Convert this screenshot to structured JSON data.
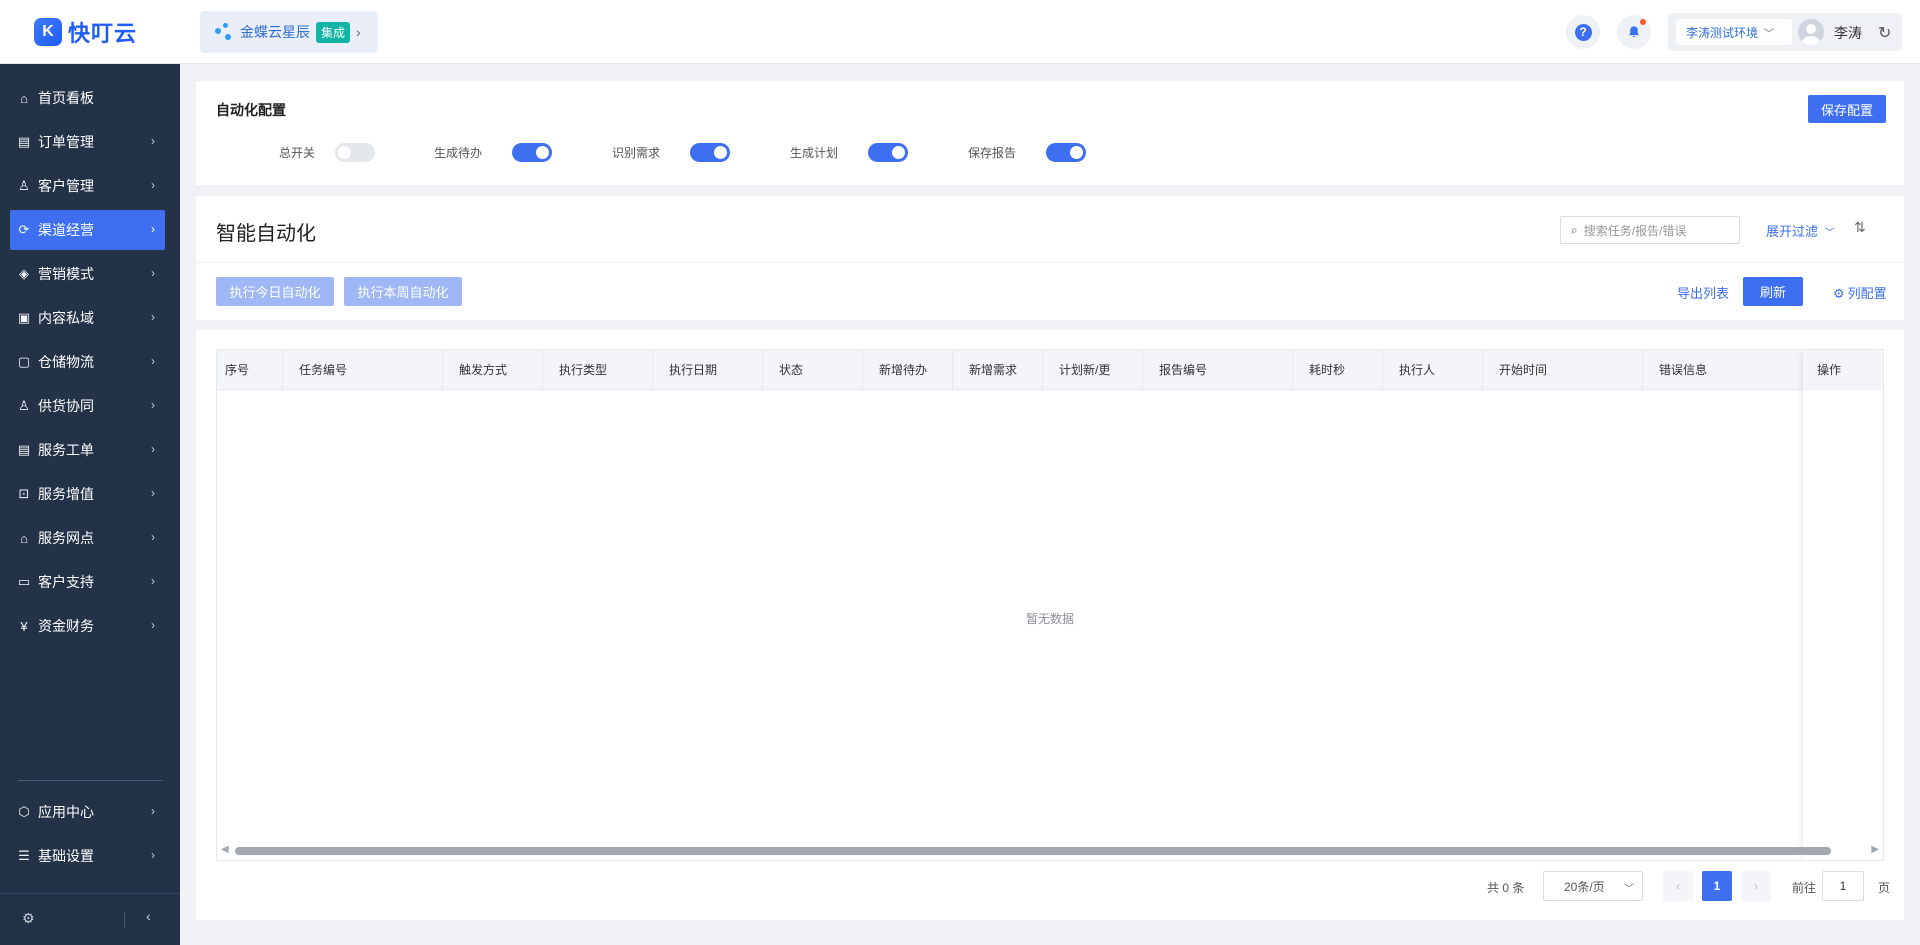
{
  "brand": {
    "name": "快叮云",
    "mark": "K"
  },
  "product": {
    "name": "金蝶云星辰",
    "tag": "集成",
    "chevron": "chevron-right-icon"
  },
  "header": {
    "help_icon": "question-icon",
    "notification_icon": "bell-icon",
    "environment": "李涛测试环境",
    "user_name": "李涛",
    "refresh_icon": "refresh-icon"
  },
  "sidebar": {
    "items": [
      {
        "label": "首页看板",
        "icon": "home-icon",
        "chevron": false,
        "active": false
      },
      {
        "label": "订单管理",
        "icon": "clipboard-icon",
        "chevron": true,
        "active": false
      },
      {
        "label": "客户管理",
        "icon": "user-icon",
        "chevron": true,
        "active": false
      },
      {
        "label": "渠道经营",
        "icon": "channel-icon",
        "chevron": true,
        "active": true
      },
      {
        "label": "营销模式",
        "icon": "tag-icon",
        "chevron": true,
        "active": false
      },
      {
        "label": "内容私域",
        "icon": "image-icon",
        "chevron": true,
        "active": false
      },
      {
        "label": "仓储物流",
        "icon": "warehouse-icon",
        "chevron": true,
        "active": false
      },
      {
        "label": "供货协同",
        "icon": "supply-icon",
        "chevron": true,
        "active": false
      },
      {
        "label": "服务工单",
        "icon": "ticket-icon",
        "chevron": true,
        "active": false
      },
      {
        "label": "服务增值",
        "icon": "bag-icon",
        "chevron": true,
        "active": false
      },
      {
        "label": "服务网点",
        "icon": "store-icon",
        "chevron": true,
        "active": false
      },
      {
        "label": "客户支持",
        "icon": "support-icon",
        "chevron": true,
        "active": false
      },
      {
        "label": "资金财务",
        "icon": "yen-icon",
        "chevron": true,
        "active": false
      }
    ],
    "bottom_items": [
      {
        "label": "应用中心",
        "icon": "cube-icon"
      },
      {
        "label": "基础设置",
        "icon": "sliders-icon"
      }
    ]
  },
  "config": {
    "title": "自动化配置",
    "save_label": "保存配置",
    "toggles": [
      {
        "label": "总开关",
        "on": false
      },
      {
        "label": "生成待办",
        "on": true
      },
      {
        "label": "识别需求",
        "on": true
      },
      {
        "label": "生成计划",
        "on": true
      },
      {
        "label": "保存报告",
        "on": true
      }
    ]
  },
  "main": {
    "title": "智能自动化",
    "search_placeholder": "搜索任务/报告/错误",
    "expand_filter": "展开过滤",
    "run_today": "执行今日自动化",
    "run_week": "执行本周自动化",
    "export": "导出列表",
    "refresh": "刷新",
    "column_config": "列配置",
    "empty": "暂无数据"
  },
  "table": {
    "columns": [
      "序号",
      "任务编号",
      "触发方式",
      "执行类型",
      "执行日期",
      "状态",
      "新增待办",
      "新增需求",
      "计划新/更",
      "报告编号",
      "耗时秒",
      "执行人",
      "开始时间",
      "错误信息"
    ],
    "fixed_column": "操作",
    "rows": []
  },
  "pagination": {
    "total": "共 0 条",
    "page_size": "20条/页",
    "current_page": "1",
    "goto_prefix": "前往",
    "goto_value": "1",
    "goto_suffix": "页"
  },
  "colors": {
    "primary": "#3d6ff0",
    "sidebar_bg": "#243248",
    "teal_tag": "#12b4a6"
  }
}
